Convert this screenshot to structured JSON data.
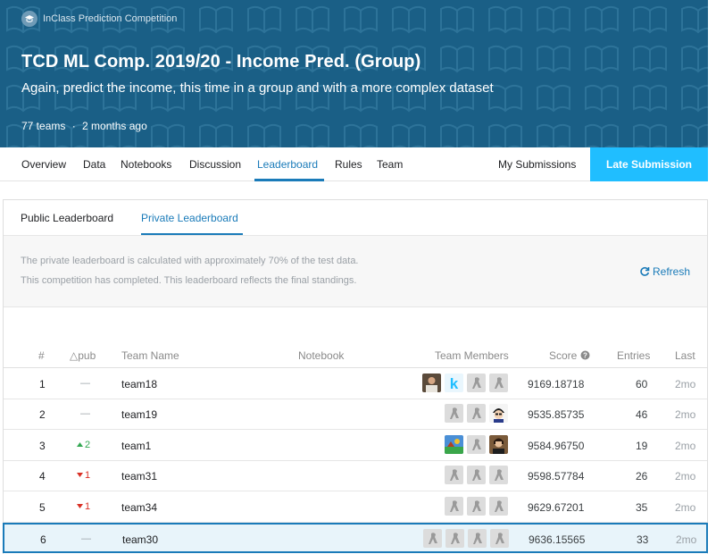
{
  "header": {
    "competition_type": "InClass Prediction Competition",
    "title": "TCD ML Comp. 2019/20 - Income Pred. (Group)",
    "subtitle": "Again, predict the income, this time in a group and with a more complex dataset",
    "teams": "77 teams",
    "separator": "·",
    "age": "2 months ago"
  },
  "nav": {
    "items": [
      "Overview",
      "Data",
      "Notebooks",
      "Discussion",
      "Leaderboard",
      "Rules",
      "Team"
    ],
    "active": "Leaderboard",
    "my_submissions": "My Submissions",
    "late_submission": "Late Submission"
  },
  "subtabs": {
    "public": "Public Leaderboard",
    "private": "Private Leaderboard",
    "active": "Private Leaderboard"
  },
  "info": {
    "line1": "The private leaderboard is calculated with approximately 70% of the test data.",
    "line2": "This competition has completed. This leaderboard reflects the final standings.",
    "refresh": "Refresh"
  },
  "table": {
    "headers": {
      "rank": "#",
      "delta": "△pub",
      "team_name": "Team Name",
      "notebook": "Notebook",
      "team_members": "Team Members",
      "score": "Score",
      "entries": "Entries",
      "last": "Last"
    },
    "rows": [
      {
        "rank": "1",
        "delta": "—",
        "delta_dir": "none",
        "team": "team18",
        "members": [
          "photo-man",
          "kaggle-k",
          "default",
          "default"
        ],
        "score": "9169.18718",
        "entries": "60",
        "last": "2mo"
      },
      {
        "rank": "2",
        "delta": "—",
        "delta_dir": "none",
        "team": "team19",
        "members": [
          "default",
          "default",
          "cartoon"
        ],
        "score": "9535.85735",
        "entries": "46",
        "last": "2mo"
      },
      {
        "rank": "3",
        "delta": "2",
        "delta_dir": "up",
        "team": "team1",
        "members": [
          "landscape",
          "default",
          "photo-woman"
        ],
        "score": "9584.96750",
        "entries": "19",
        "last": "2mo"
      },
      {
        "rank": "4",
        "delta": "1",
        "delta_dir": "down",
        "team": "team31",
        "members": [
          "default",
          "default",
          "default"
        ],
        "score": "9598.57784",
        "entries": "26",
        "last": "2mo"
      },
      {
        "rank": "5",
        "delta": "1",
        "delta_dir": "down",
        "team": "team34",
        "members": [
          "default",
          "default",
          "default"
        ],
        "score": "9629.67201",
        "entries": "35",
        "last": "2mo"
      },
      {
        "rank": "6",
        "delta": "—",
        "delta_dir": "none",
        "team": "team30",
        "members": [
          "default",
          "default",
          "default",
          "default"
        ],
        "score": "9636.15565",
        "entries": "33",
        "last": "2mo"
      }
    ]
  },
  "colors": {
    "banner": "#1a5f86",
    "accent": "#1a7bb9",
    "late_button": "#20beff",
    "up": "#34a853",
    "down": "#d93025"
  }
}
